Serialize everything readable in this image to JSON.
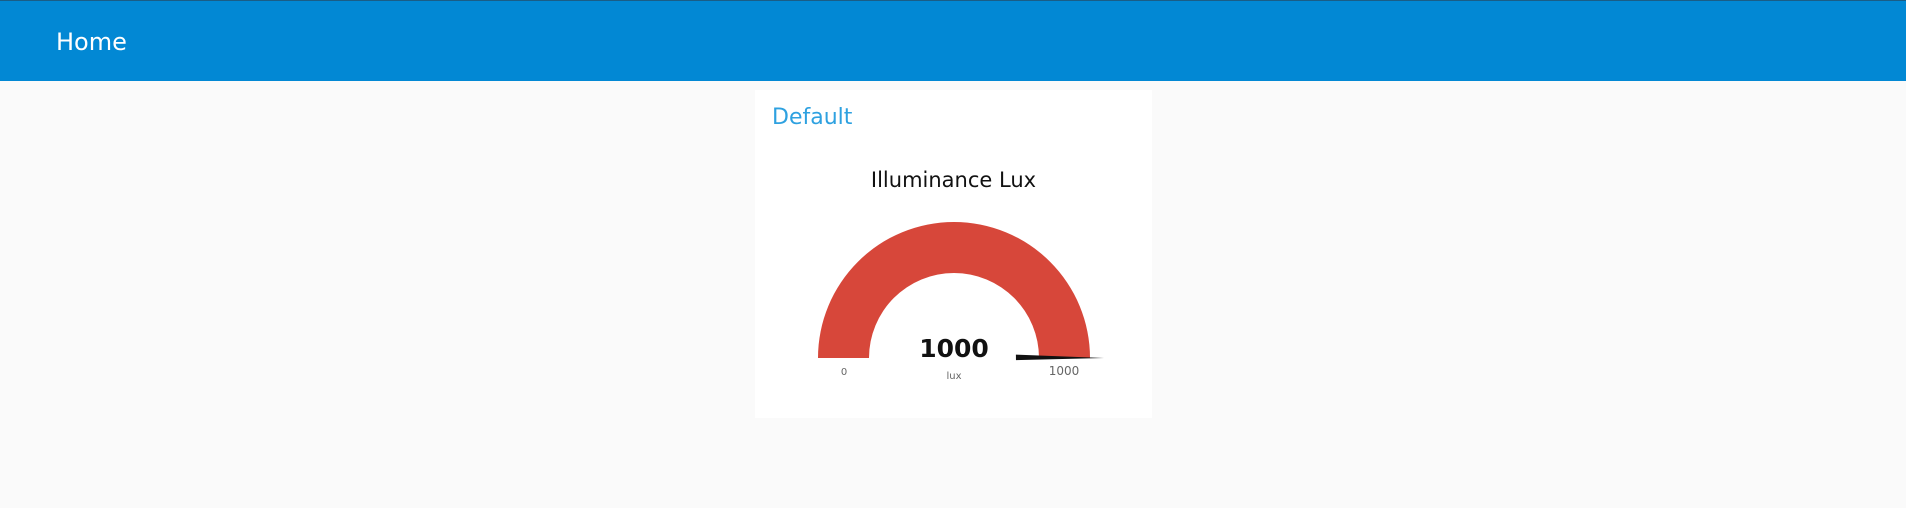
{
  "toolbar": {
    "title": "Home",
    "color": "#0288d4"
  },
  "group": {
    "title": "Default"
  },
  "gauge": {
    "title": "Illuminance Lux",
    "value": 1000,
    "value_label": "1000",
    "units": "lux",
    "min": 0,
    "max": 1000,
    "min_label": "0",
    "max_label": "1000",
    "arc_color": "#d7473a",
    "needle_color": "#111111"
  }
}
